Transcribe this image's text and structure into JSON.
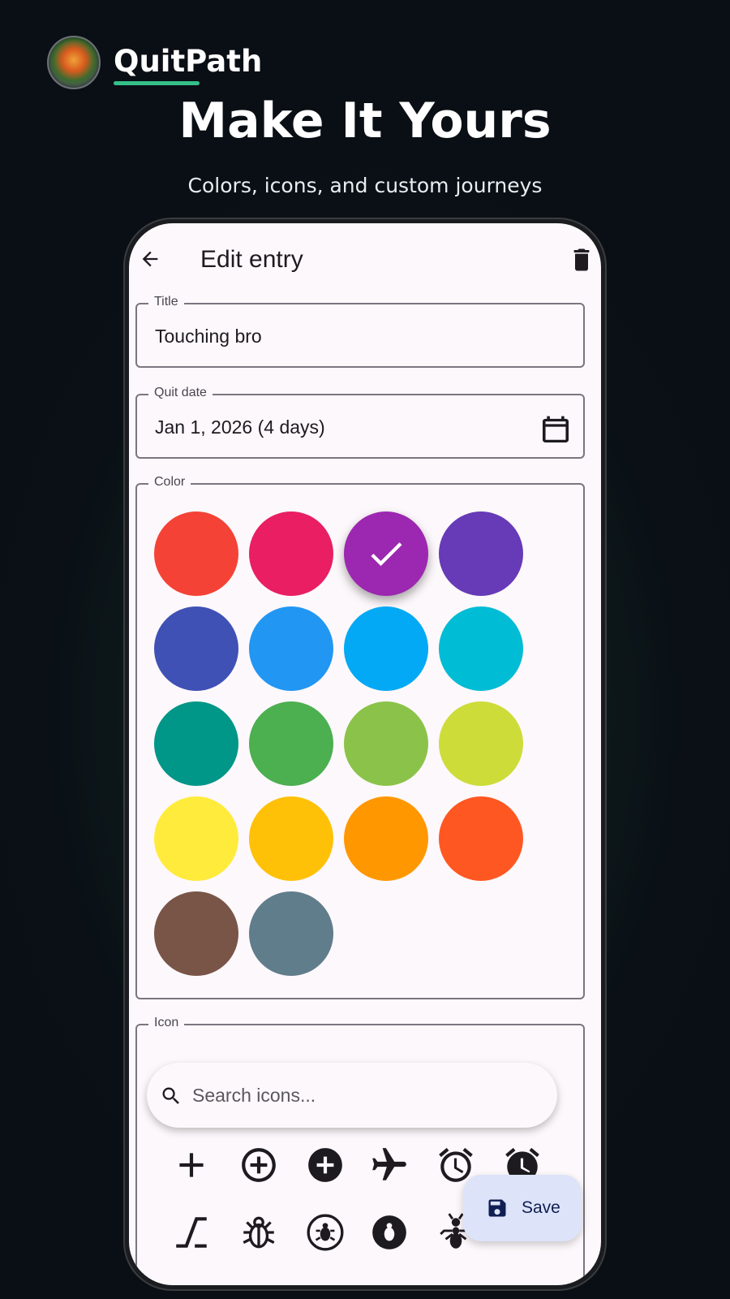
{
  "brand": {
    "name": "QuitPath",
    "accent": "#35c08a"
  },
  "promo": {
    "headline": "Make It Yours",
    "subhead": "Colors, icons, and custom journeys"
  },
  "appbar": {
    "title": "Edit entry",
    "back_icon": "arrow-back-icon",
    "delete_icon": "trash-icon"
  },
  "form": {
    "title": {
      "label": "Title",
      "value": "Touching bro"
    },
    "quit_date": {
      "label": "Quit date",
      "value": "Jan 1, 2026 (4 days)",
      "icon": "calendar-icon"
    },
    "color": {
      "label": "Color",
      "selected": "#9c27b0",
      "swatches": [
        "#f44336",
        "#e91e63",
        "#9c27b0",
        "#673ab7",
        "#3f51b5",
        "#2196f3",
        "#03a9f4",
        "#00bcd4",
        "#009688",
        "#4caf50",
        "#8bc34a",
        "#cddc39",
        "#ffeb3b",
        "#ffc107",
        "#ff9800",
        "#ff5722",
        "#795548",
        "#607d8b"
      ]
    },
    "icon": {
      "label": "Icon",
      "search_placeholder": "Search icons...",
      "icons": [
        "add-icon",
        "add-circle-outline-icon",
        "add-circle-icon",
        "airplane-icon",
        "alarm-outline-icon",
        "alarm-icon",
        "analytics-icon",
        "bug-outline-icon",
        "bug-circle-outline-icon",
        "bug-circle-icon",
        "ant-icon"
      ]
    }
  },
  "fab": {
    "label": "Save",
    "icon": "save-icon",
    "color": "#dde3f8"
  }
}
